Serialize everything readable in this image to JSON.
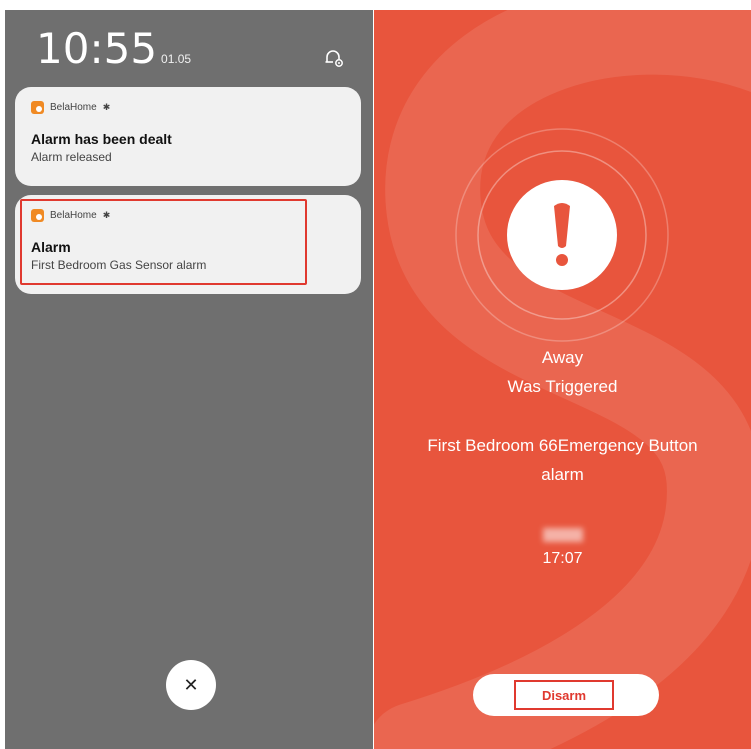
{
  "lockscreen": {
    "time": "10:55",
    "date": "01.05"
  },
  "notifications": [
    {
      "app": "BelaHome",
      "title": "Alarm has been dealt",
      "body": "Alarm released"
    },
    {
      "app": "BelaHome",
      "title": "Alarm",
      "body": "First Bedroom Gas Sensor alarm"
    }
  ],
  "alarm_screen": {
    "mode": "Away",
    "status": "Was Triggered",
    "device_line1": "First Bedroom 66Emergency Button",
    "device_line2": "alarm",
    "time": "17:07",
    "disarm_label": "Disarm"
  },
  "colors": {
    "shade_bg": "#6f6f6f",
    "alarm_bg": "#e8553d",
    "highlight": "#e0392f",
    "app_icon": "#f08a24"
  },
  "icons": {
    "notification_settings": "bell-gear-icon",
    "app": "belahome-logo-icon",
    "alarm_badge": "siren-icon",
    "close": "close-icon",
    "alert": "exclamation-icon"
  }
}
